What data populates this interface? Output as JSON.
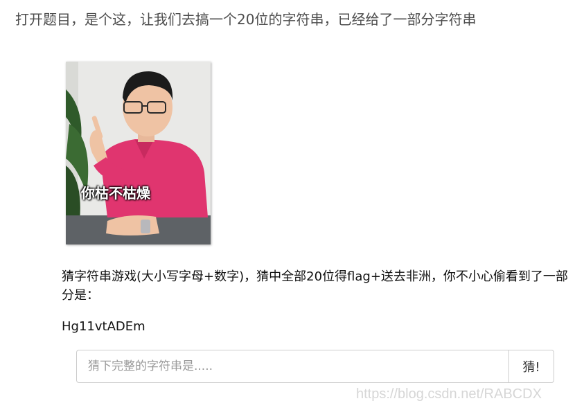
{
  "article": {
    "intro": "打开题目，是个这，让我们去搞一个20位的字符串，已经给了一部分字符串"
  },
  "meme": {
    "caption": "你枯不枯燥"
  },
  "game": {
    "description": "猜字符串游戏(大小写字母+数字)，猜中全部20位得flag+送去非洲，你不小心偷看到了一部分是：",
    "partial_string": "Hg11vtADEm",
    "input_placeholder": "猜下完整的字符串是.....",
    "submit_label": "猜!"
  },
  "watermark": "https://blog.csdn.net/RABCDX"
}
